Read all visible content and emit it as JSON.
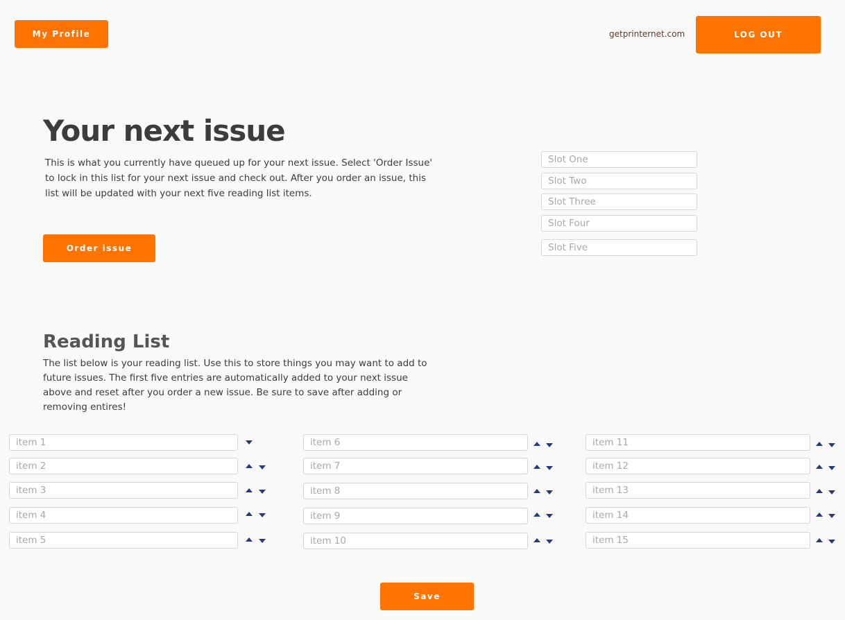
{
  "header": {
    "profile_label": "My Profile",
    "site_link": "getprinternet.com",
    "logout_label": "LOG OUT"
  },
  "next_issue": {
    "title": "Your next issue",
    "description": "This is what you currently have queued up for your next issue. Select 'Order Issue' to lock in this list for your next issue and check out. After you order an issue, this list will be updated with your next five reading list items.",
    "order_label": "Order issue",
    "slots": [
      {
        "placeholder": "Slot One",
        "value": ""
      },
      {
        "placeholder": "Slot Two",
        "value": ""
      },
      {
        "placeholder": "Slot Three",
        "value": ""
      },
      {
        "placeholder": "Slot Four",
        "value": ""
      },
      {
        "placeholder": "Slot Five",
        "value": ""
      }
    ]
  },
  "reading_list": {
    "title": "Reading List",
    "description": "The list below is your reading list. Use this to store things you may want to add to future issues. The first five entries are automatically added to your next issue above and reset after you order a new issue. Be sure to save after adding or removing entires!",
    "items": [
      {
        "placeholder": "item 1"
      },
      {
        "placeholder": "item 2"
      },
      {
        "placeholder": "item 3"
      },
      {
        "placeholder": "item 4"
      },
      {
        "placeholder": "item 5"
      },
      {
        "placeholder": "item 6"
      },
      {
        "placeholder": "item 7"
      },
      {
        "placeholder": "item 8"
      },
      {
        "placeholder": "item 9"
      },
      {
        "placeholder": "item 10"
      },
      {
        "placeholder": "item 11"
      },
      {
        "placeholder": "item 12"
      },
      {
        "placeholder": "item 13"
      },
      {
        "placeholder": "item 14"
      },
      {
        "placeholder": "item 15"
      }
    ],
    "save_label": "Save"
  },
  "icons": {
    "move_up": "caret-up-icon",
    "move_down": "caret-down-icon"
  },
  "colors": {
    "accent": "#ff7300",
    "arrow": "#2a3a78",
    "background": "#f9f9f9"
  }
}
